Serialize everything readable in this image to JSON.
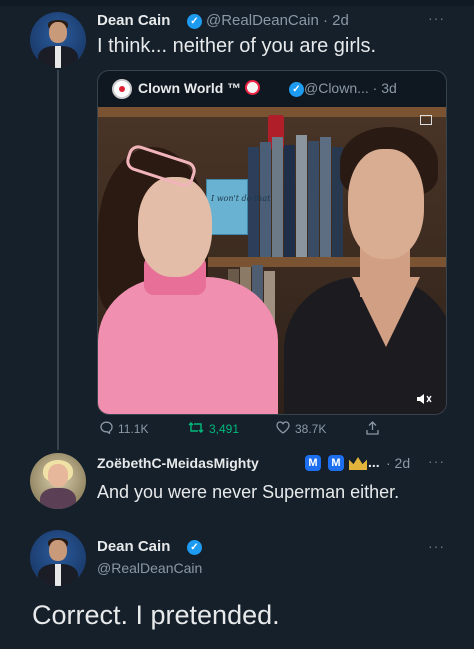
{
  "tweet1": {
    "name": "Dean Cain",
    "handle": "@RealDeanCain",
    "time": "· 2d",
    "text": "I think... neither of you are girls.",
    "more": "···"
  },
  "embed": {
    "name": "Clown World ™",
    "handle": "@Clown... · 3d",
    "book_text": "I won't do that",
    "stats": {
      "replies": "11.1K",
      "retweets": "3,491",
      "likes": "38.7K"
    }
  },
  "tweet2": {
    "name": "ZoëbethC-MeidasMighty",
    "badges": [
      "M",
      "M"
    ],
    "ellipsis": "...",
    "time": "· 2d",
    "text": "And you were never Superman either.",
    "more": "···"
  },
  "tweet3": {
    "name": "Dean Cain",
    "handle": "@RealDeanCain",
    "text": "Correct. I pretended.",
    "more": "···"
  },
  "colors": {
    "background": "#15202b",
    "verified": "#1d9bf0",
    "retweet": "#00ba7c",
    "secondary_text": "#8b98a5"
  },
  "icons": [
    "verified-badge-icon",
    "reply-icon",
    "retweet-icon",
    "like-icon",
    "share-icon",
    "mute-icon",
    "clown-emoji-icon",
    "crown-icon"
  ]
}
